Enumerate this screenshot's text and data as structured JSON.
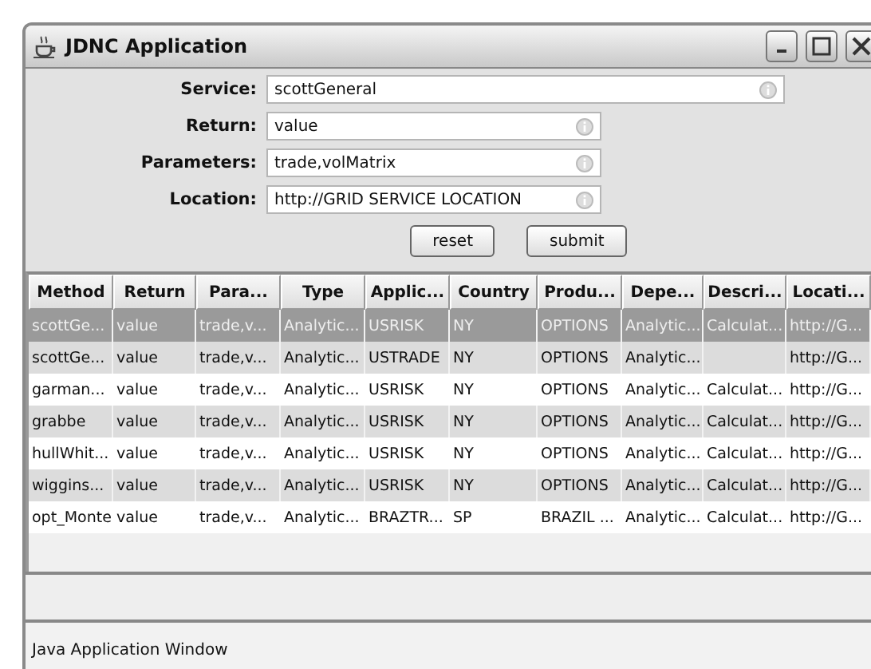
{
  "window": {
    "title": "JDNC Application"
  },
  "form": {
    "fields": [
      {
        "label": "Service:",
        "value": "scottGeneral",
        "wide": true
      },
      {
        "label": "Return:",
        "value": "value",
        "wide": false
      },
      {
        "label": "Parameters:",
        "value": "trade,volMatrix",
        "wide": false
      },
      {
        "label": "Location:",
        "value": "http://GRID SERVICE LOCATION",
        "wide": false
      }
    ],
    "buttons": [
      "reset",
      "submit"
    ]
  },
  "table": {
    "columns": [
      "Method",
      "Return",
      "Para...",
      "Type",
      "Applic...",
      "Country",
      "Produ...",
      "Depe...",
      "Descri...",
      "Locati..."
    ],
    "rows": [
      {
        "selected": true,
        "cells": [
          "scottGe...",
          "value",
          "trade,v...",
          "Analytic...",
          "USRISK",
          "NY",
          "OPTIONS",
          "Analytic...",
          "Calculat...",
          "http://G..."
        ]
      },
      {
        "selected": false,
        "cells": [
          "scottGe...",
          "value",
          "trade,v...",
          "Analytic...",
          "USTRADE",
          "NY",
          "OPTIONS",
          "Analytic...",
          "",
          "http://G..."
        ]
      },
      {
        "selected": false,
        "cells": [
          "garman...",
          "value",
          "trade,v...",
          "Analytic...",
          "USRISK",
          "NY",
          "OPTIONS",
          "Analytic...",
          "Calculat...",
          "http://G..."
        ]
      },
      {
        "selected": false,
        "cells": [
          "grabbe",
          "value",
          "trade,v...",
          "Analytic...",
          "USRISK",
          "NY",
          "OPTIONS",
          "Analytic...",
          "Calculat...",
          "http://G..."
        ]
      },
      {
        "selected": false,
        "cells": [
          "hullWhit...",
          "value",
          "trade,v...",
          "Analytic...",
          "USRISK",
          "NY",
          "OPTIONS",
          "Analytic...",
          "Calculat...",
          "http://G..."
        ]
      },
      {
        "selected": false,
        "cells": [
          "wiggins...",
          "value",
          "trade,v...",
          "Analytic...",
          "USRISK",
          "NY",
          "OPTIONS",
          "Analytic...",
          "Calculat...",
          "http://G..."
        ]
      },
      {
        "selected": false,
        "cells": [
          "opt_Monte",
          "value",
          "trade,v...",
          "Analytic...",
          "BRAZTR...",
          "SP",
          "BRAZIL ...",
          "Analytic...",
          "Calculat...",
          "http://G..."
        ]
      }
    ]
  },
  "status_bar": "Java Application Window"
}
